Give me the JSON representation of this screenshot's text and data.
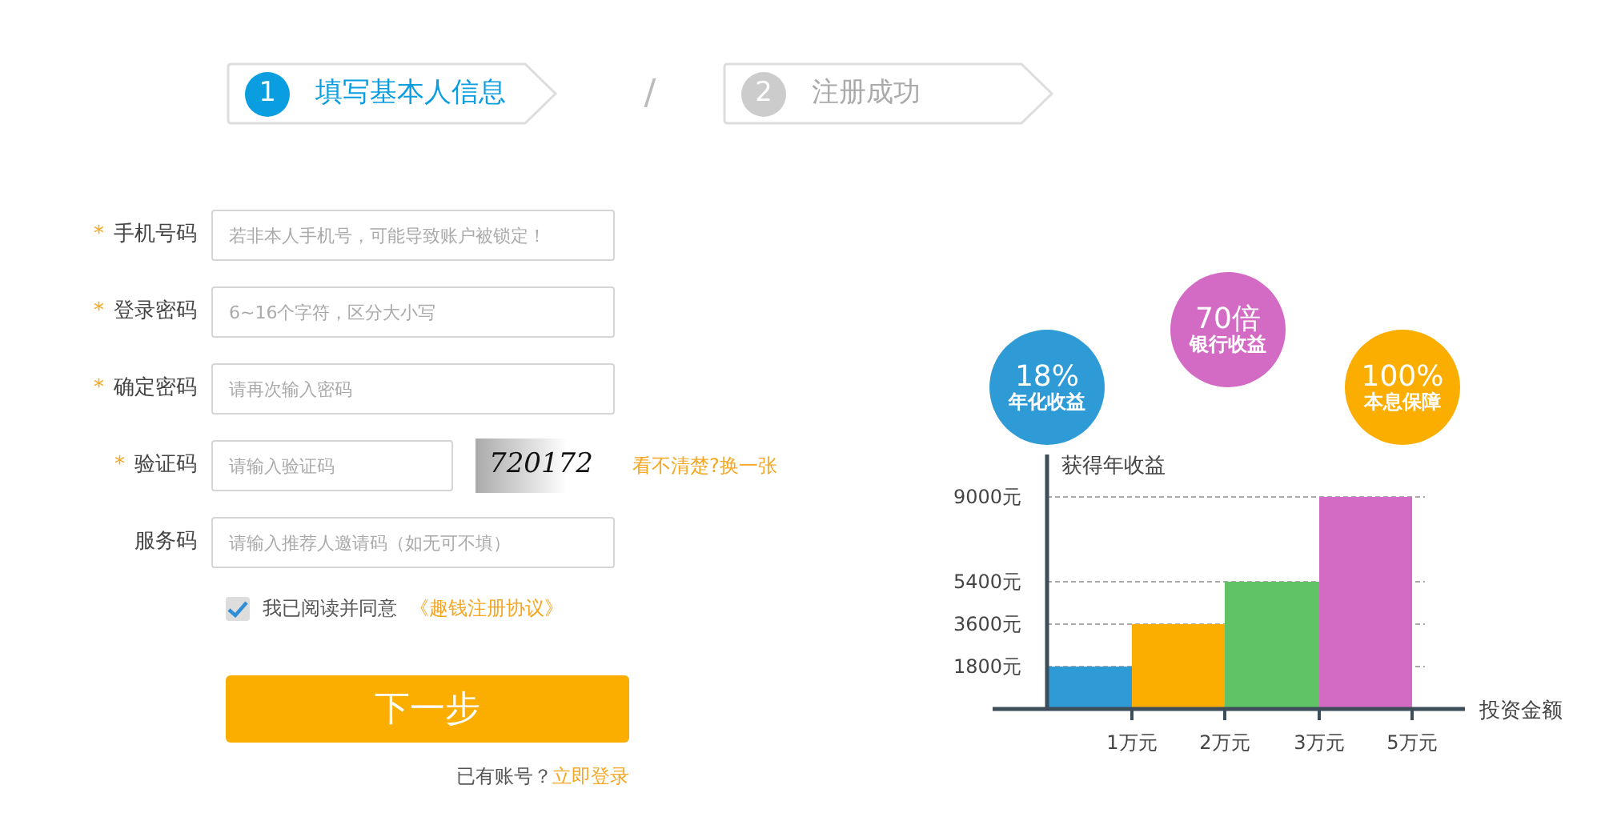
{
  "steps": [
    {
      "number": "1",
      "label": "填写基本人信息",
      "selected": true
    },
    {
      "number": "2",
      "label": "注册成功",
      "selected": false
    }
  ],
  "separator": "/",
  "fields": [
    {
      "kind": "text",
      "required": true,
      "label": "手机号码",
      "placeholder": "若非本人手机号，可能导致账户被锁定！"
    },
    {
      "kind": "text",
      "required": true,
      "label": "登录密码",
      "placeholder": "6~16个字符，区分大小写"
    },
    {
      "kind": "text",
      "required": true,
      "label": "确定密码",
      "placeholder": "请再次输入密码"
    },
    {
      "kind": "captcha",
      "required": true,
      "label": "验证码",
      "placeholder": "请输入验证码",
      "captcha": "720172",
      "refresh": "看不清楚?换一张"
    },
    {
      "kind": "text",
      "required": false,
      "label": "服务码",
      "placeholder": "请输入推荐人邀请码（如无可不填）"
    }
  ],
  "required_mark": "*",
  "agreement": {
    "checked": true,
    "text": "我已阅读并同意",
    "link": "《趣钱注册协议》"
  },
  "submit": "下一步",
  "login": {
    "text": "已有账号？",
    "link": "立即登录"
  },
  "badges": [
    {
      "value": "18%",
      "label": "年化收益",
      "color": "#2e9ad6"
    },
    {
      "value": "70倍",
      "label": "银行收益",
      "color": "#d36bc5"
    },
    {
      "value": "100%",
      "label": "本息保障",
      "color": "#fbae00"
    }
  ],
  "chart": {
    "chart_data": {
      "type": "bar",
      "ylabel": "获得年收益",
      "xlabel": "投资金额",
      "categories": [
        "1万元",
        "2万元",
        "3万元",
        "5万元"
      ],
      "series": [
        {
          "color": "#2e9ad6",
          "values": [
            1800,
            null,
            null,
            null
          ]
        },
        {
          "color": "#fbae00",
          "values": [
            null,
            3600,
            null,
            null
          ]
        },
        {
          "color": "#60c466",
          "values": [
            null,
            null,
            5400,
            null
          ]
        },
        {
          "color": "#d36bc5",
          "values": [
            null,
            null,
            null,
            9000
          ]
        }
      ],
      "grid": true,
      "ylim": [
        0,
        10800
      ],
      "yticks": [
        {
          "value": 1800,
          "label": "1800元"
        },
        {
          "value": 3600,
          "label": "3600元"
        },
        {
          "value": 5400,
          "label": "5400元"
        },
        {
          "value": 9000,
          "label": "9000元"
        }
      ]
    }
  }
}
